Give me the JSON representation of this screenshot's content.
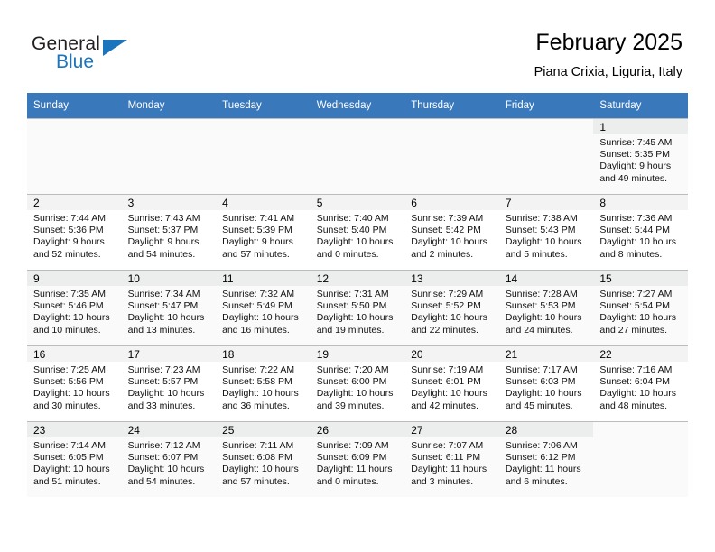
{
  "brand": {
    "name_part1": "General",
    "name_part2": "Blue",
    "accent_color": "#1c75bc"
  },
  "header": {
    "title": "February 2025",
    "subtitle": "Piana Crixia, Liguria, Italy"
  },
  "calendar": {
    "header_bg": "#3a78bc",
    "weekday_headers": [
      "Sunday",
      "Monday",
      "Tuesday",
      "Wednesday",
      "Thursday",
      "Friday",
      "Saturday"
    ],
    "weeks": [
      [
        {
          "day": "",
          "lines": []
        },
        {
          "day": "",
          "lines": []
        },
        {
          "day": "",
          "lines": []
        },
        {
          "day": "",
          "lines": []
        },
        {
          "day": "",
          "lines": []
        },
        {
          "day": "",
          "lines": []
        },
        {
          "day": "1",
          "lines": [
            "Sunrise: 7:45 AM",
            "Sunset: 5:35 PM",
            "Daylight: 9 hours",
            "and 49 minutes."
          ]
        }
      ],
      [
        {
          "day": "2",
          "lines": [
            "Sunrise: 7:44 AM",
            "Sunset: 5:36 PM",
            "Daylight: 9 hours",
            "and 52 minutes."
          ]
        },
        {
          "day": "3",
          "lines": [
            "Sunrise: 7:43 AM",
            "Sunset: 5:37 PM",
            "Daylight: 9 hours",
            "and 54 minutes."
          ]
        },
        {
          "day": "4",
          "lines": [
            "Sunrise: 7:41 AM",
            "Sunset: 5:39 PM",
            "Daylight: 9 hours",
            "and 57 minutes."
          ]
        },
        {
          "day": "5",
          "lines": [
            "Sunrise: 7:40 AM",
            "Sunset: 5:40 PM",
            "Daylight: 10 hours",
            "and 0 minutes."
          ]
        },
        {
          "day": "6",
          "lines": [
            "Sunrise: 7:39 AM",
            "Sunset: 5:42 PM",
            "Daylight: 10 hours",
            "and 2 minutes."
          ]
        },
        {
          "day": "7",
          "lines": [
            "Sunrise: 7:38 AM",
            "Sunset: 5:43 PM",
            "Daylight: 10 hours",
            "and 5 minutes."
          ]
        },
        {
          "day": "8",
          "lines": [
            "Sunrise: 7:36 AM",
            "Sunset: 5:44 PM",
            "Daylight: 10 hours",
            "and 8 minutes."
          ]
        }
      ],
      [
        {
          "day": "9",
          "lines": [
            "Sunrise: 7:35 AM",
            "Sunset: 5:46 PM",
            "Daylight: 10 hours",
            "and 10 minutes."
          ]
        },
        {
          "day": "10",
          "lines": [
            "Sunrise: 7:34 AM",
            "Sunset: 5:47 PM",
            "Daylight: 10 hours",
            "and 13 minutes."
          ]
        },
        {
          "day": "11",
          "lines": [
            "Sunrise: 7:32 AM",
            "Sunset: 5:49 PM",
            "Daylight: 10 hours",
            "and 16 minutes."
          ]
        },
        {
          "day": "12",
          "lines": [
            "Sunrise: 7:31 AM",
            "Sunset: 5:50 PM",
            "Daylight: 10 hours",
            "and 19 minutes."
          ]
        },
        {
          "day": "13",
          "lines": [
            "Sunrise: 7:29 AM",
            "Sunset: 5:52 PM",
            "Daylight: 10 hours",
            "and 22 minutes."
          ]
        },
        {
          "day": "14",
          "lines": [
            "Sunrise: 7:28 AM",
            "Sunset: 5:53 PM",
            "Daylight: 10 hours",
            "and 24 minutes."
          ]
        },
        {
          "day": "15",
          "lines": [
            "Sunrise: 7:27 AM",
            "Sunset: 5:54 PM",
            "Daylight: 10 hours",
            "and 27 minutes."
          ]
        }
      ],
      [
        {
          "day": "16",
          "lines": [
            "Sunrise: 7:25 AM",
            "Sunset: 5:56 PM",
            "Daylight: 10 hours",
            "and 30 minutes."
          ]
        },
        {
          "day": "17",
          "lines": [
            "Sunrise: 7:23 AM",
            "Sunset: 5:57 PM",
            "Daylight: 10 hours",
            "and 33 minutes."
          ]
        },
        {
          "day": "18",
          "lines": [
            "Sunrise: 7:22 AM",
            "Sunset: 5:58 PM",
            "Daylight: 10 hours",
            "and 36 minutes."
          ]
        },
        {
          "day": "19",
          "lines": [
            "Sunrise: 7:20 AM",
            "Sunset: 6:00 PM",
            "Daylight: 10 hours",
            "and 39 minutes."
          ]
        },
        {
          "day": "20",
          "lines": [
            "Sunrise: 7:19 AM",
            "Sunset: 6:01 PM",
            "Daylight: 10 hours",
            "and 42 minutes."
          ]
        },
        {
          "day": "21",
          "lines": [
            "Sunrise: 7:17 AM",
            "Sunset: 6:03 PM",
            "Daylight: 10 hours",
            "and 45 minutes."
          ]
        },
        {
          "day": "22",
          "lines": [
            "Sunrise: 7:16 AM",
            "Sunset: 6:04 PM",
            "Daylight: 10 hours",
            "and 48 minutes."
          ]
        }
      ],
      [
        {
          "day": "23",
          "lines": [
            "Sunrise: 7:14 AM",
            "Sunset: 6:05 PM",
            "Daylight: 10 hours",
            "and 51 minutes."
          ]
        },
        {
          "day": "24",
          "lines": [
            "Sunrise: 7:12 AM",
            "Sunset: 6:07 PM",
            "Daylight: 10 hours",
            "and 54 minutes."
          ]
        },
        {
          "day": "25",
          "lines": [
            "Sunrise: 7:11 AM",
            "Sunset: 6:08 PM",
            "Daylight: 10 hours",
            "and 57 minutes."
          ]
        },
        {
          "day": "26",
          "lines": [
            "Sunrise: 7:09 AM",
            "Sunset: 6:09 PM",
            "Daylight: 11 hours",
            "and 0 minutes."
          ]
        },
        {
          "day": "27",
          "lines": [
            "Sunrise: 7:07 AM",
            "Sunset: 6:11 PM",
            "Daylight: 11 hours",
            "and 3 minutes."
          ]
        },
        {
          "day": "28",
          "lines": [
            "Sunrise: 7:06 AM",
            "Sunset: 6:12 PM",
            "Daylight: 11 hours",
            "and 6 minutes."
          ]
        },
        {
          "day": "",
          "lines": []
        }
      ]
    ]
  }
}
